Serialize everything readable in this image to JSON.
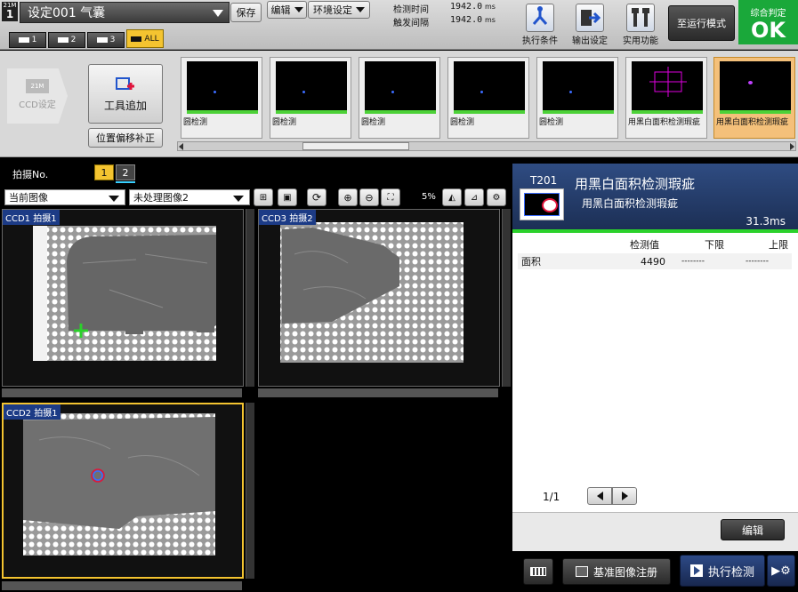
{
  "header": {
    "logo_top": "21M",
    "logo_num": "1",
    "setting_title": "设定001  气囊",
    "save_label": "保存",
    "edit_label": "编辑",
    "env_label": "环境设定",
    "detect_time_label": "检测时间",
    "detect_time_value": "1942.0",
    "trigger_label": "触发间隔",
    "trigger_value": "1942.0",
    "unit": "ms",
    "exec_condition": "执行条件",
    "output_setting": "输出设定",
    "utility": "实用功能",
    "run_mode": "至运行模式",
    "judge_label": "综合判定",
    "judge_value": "OK"
  },
  "ccd_tabs": [
    {
      "label": "1"
    },
    {
      "label": "2"
    },
    {
      "label": "3"
    },
    {
      "label": "ALL",
      "active": true
    }
  ],
  "toolbar2": {
    "ccd_setting_top": "21M",
    "ccd_setting": "CCD设定",
    "tool_add": "工具追加",
    "position_offset": "位置偏移补正"
  },
  "thumbnails": [
    {
      "label": "圆检测"
    },
    {
      "label": "圆检测"
    },
    {
      "label": "圆检测"
    },
    {
      "label": "圆检测"
    },
    {
      "label": "圆检测"
    },
    {
      "label": "用黑白面积检测瑕疵"
    },
    {
      "label": "用黑白面积检测瑕疵",
      "selected": true
    }
  ],
  "capture": {
    "label": "拍摄No.",
    "tabs": [
      "1",
      "2"
    ]
  },
  "image_controls": {
    "current_image": "当前图像",
    "unprocessed": "未处理图像2",
    "zoom": "5%"
  },
  "views": [
    {
      "label": "CCD1 拍摄1"
    },
    {
      "label": "CCD3 拍摄2"
    },
    {
      "label": "CCD2 拍摄1"
    }
  ],
  "right_panel": {
    "tool_id": "T201",
    "tool_name": "用黑白面积检测瑕疵",
    "tool_sub": "用黑白面积检测瑕疵",
    "time": "31.3ms",
    "col_value": "检测值",
    "col_lower": "下限",
    "col_upper": "上限",
    "rows": [
      {
        "name": "面积",
        "value": "4490",
        "lower": "--------",
        "upper": "--------"
      }
    ],
    "page": "1/1",
    "edit_label": "编辑"
  },
  "bottom": {
    "register_label": "基准图像注册",
    "run_label": "执行检测"
  }
}
